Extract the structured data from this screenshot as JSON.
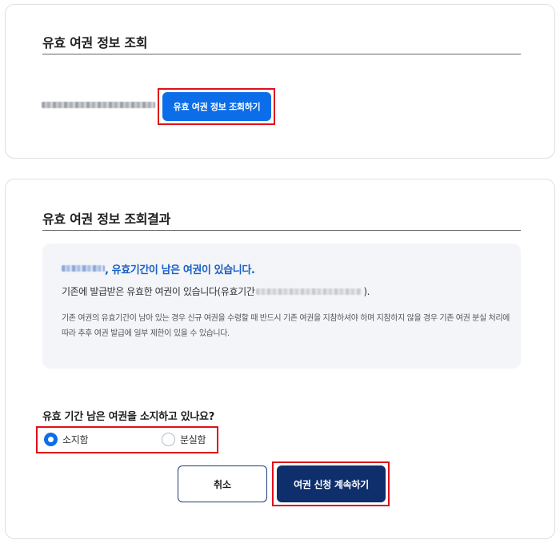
{
  "lookup": {
    "title": "유효 여권 정보 조회",
    "button_label": "유효 여권 정보 조회하기"
  },
  "result": {
    "title": "유효 여권 정보 조회결과",
    "headline_suffix": ", 유효기간이 남은 여권이 있습니다.",
    "existing_prefix": "기존에 발급받은 유효한 여권이 있습니다(유효기간 ",
    "existing_suffix": ").",
    "note": "기존 여권의 유효기간이 남아 있는 경우 신규 여권을 수령할 때 반드시 기존 여권을 지참하셔야 하며 지참하지 않을 경우 기존 여권 분실 처리에 따라 추후 여권 발급에 일부 제한이 있을 수 있습니다."
  },
  "question": {
    "label": "유효 기간 남은 여권을 소지하고 있나요?",
    "options": [
      {
        "label": "소지함",
        "selected": true
      },
      {
        "label": "분실함",
        "selected": false
      }
    ]
  },
  "actions": {
    "cancel_label": "취소",
    "continue_label": "여권 신청 계속하기"
  },
  "colors": {
    "primary": "#0b6ee8",
    "dark": "#0e2e6c",
    "highlight": "#e0101a"
  }
}
